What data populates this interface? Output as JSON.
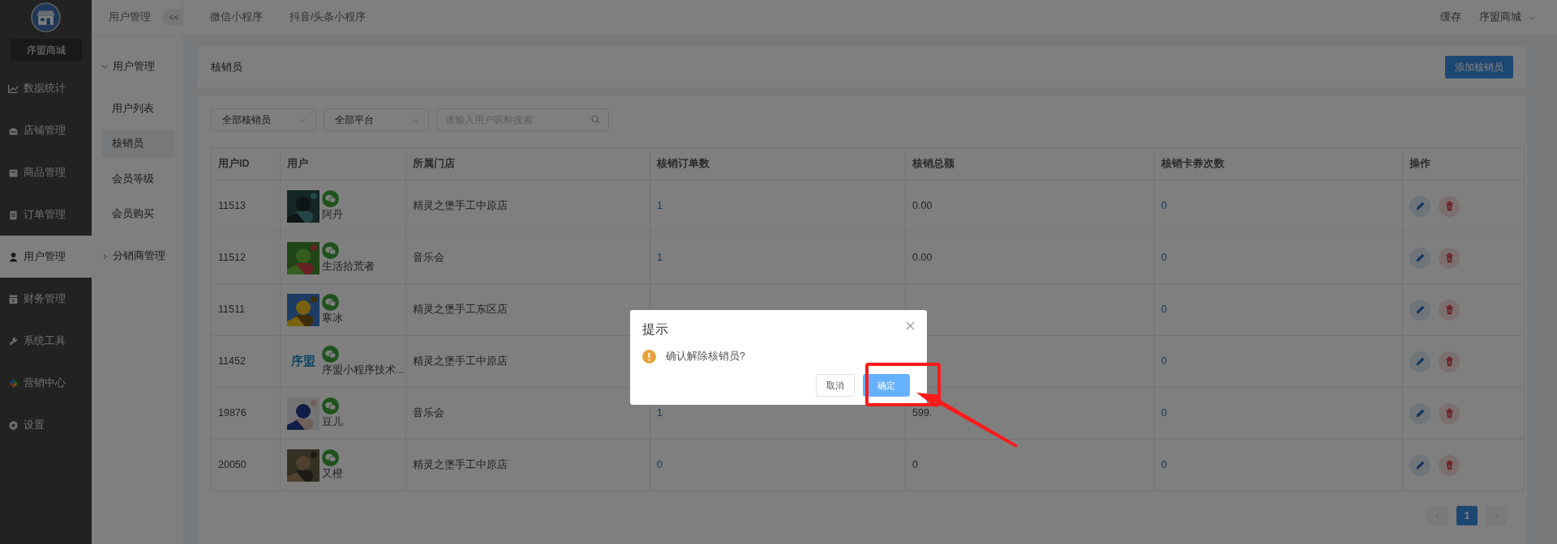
{
  "sidebar": {
    "brand": "序盟商城",
    "items": [
      {
        "label": "数据统计",
        "selected": false
      },
      {
        "label": "店铺管理",
        "selected": false
      },
      {
        "label": "商品管理",
        "selected": false
      },
      {
        "label": "订单管理",
        "selected": false
      },
      {
        "label": "用户管理",
        "selected": true
      },
      {
        "label": "财务管理",
        "selected": false
      },
      {
        "label": "系统工具",
        "selected": false
      },
      {
        "label": "营销中心",
        "selected": false
      },
      {
        "label": "设置",
        "selected": false
      }
    ]
  },
  "topbar": {
    "title": "用户管理",
    "collapse": "<<",
    "tabs": [
      "微信小程序",
      "抖音/头条小程序"
    ],
    "cache": "缓存",
    "account": "序盟商城"
  },
  "submenu": {
    "groups": [
      {
        "label": "用户管理",
        "expanded": true,
        "children": [
          {
            "label": "用户列表",
            "selected": false
          },
          {
            "label": "核销员",
            "selected": true
          },
          {
            "label": "会员等级",
            "selected": false
          },
          {
            "label": "会员购买",
            "selected": false
          }
        ]
      },
      {
        "label": "分销商管理",
        "expanded": false
      }
    ]
  },
  "page_header": {
    "title": "核销员",
    "button": "添加核销员"
  },
  "filters": {
    "selects": [
      "全部核销员",
      "全部平台"
    ],
    "search": {
      "placeholder": "请输入用户昵称搜索"
    }
  },
  "table": {
    "columns": [
      "用户ID",
      "用户",
      "所属门店",
      "核销订单数",
      "核销总额",
      "核销卡券次数",
      "操作"
    ],
    "rows": [
      {
        "id": "11513",
        "name": "阿丹",
        "store": "精灵之堡手工中原店",
        "orders": "1",
        "total": "0.00",
        "coupons": "0"
      },
      {
        "id": "11512",
        "name": "生活拾荒者",
        "store": "音乐会",
        "orders": "1",
        "total": "0.00",
        "coupons": "0"
      },
      {
        "id": "11511",
        "name": "寒冰",
        "store": "精灵之堡手工东区店",
        "coupons": "0"
      },
      {
        "id": "11452",
        "avatar": {
          "kind": "logo",
          "text": "序盟"
        },
        "name": "序盟小程序技术...",
        "store": "精灵之堡手工中原店",
        "coupons": "0"
      },
      {
        "id": "19876",
        "name": "豆儿",
        "store": "音乐会",
        "orders": "1",
        "total": "599.",
        "coupons": "0"
      },
      {
        "id": "20050",
        "name": "又橙",
        "store": "精灵之堡手工中原店",
        "orders": "0",
        "total": "0",
        "coupons": "0"
      }
    ]
  },
  "pagination": {
    "pages": [
      {
        "label": "1",
        "selected": true
      }
    ]
  },
  "dialog": {
    "title": "提示",
    "message": "确认解除核销员?",
    "buttons": [
      {
        "label": "取消",
        "kind": "secondary"
      },
      {
        "label": "确定",
        "kind": "primary"
      }
    ]
  }
}
